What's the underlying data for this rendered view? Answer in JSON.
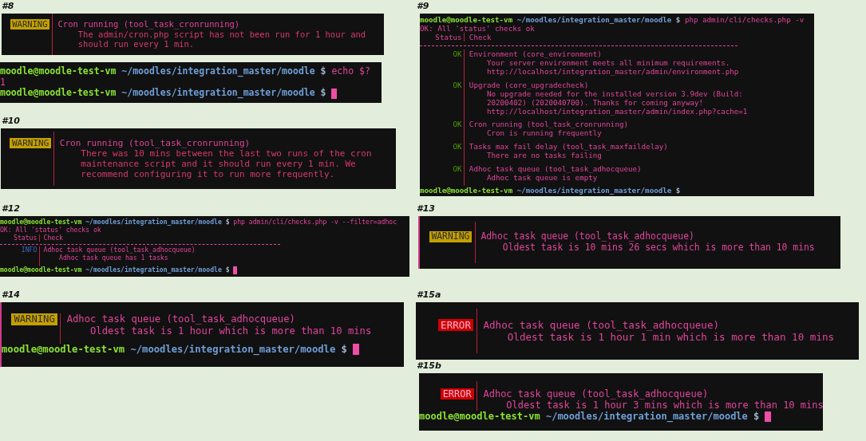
{
  "left_column": [
    {
      "label": "#8",
      "blocks": [
        {
          "lines": [
            {
              "kind": "spacer"
            },
            {
              "kind": "check",
              "status": {
                "kind": "warning",
                "text": "WARNING"
              },
              "title": "Cron running (tool_task_cronrunning)",
              "details": [
                "The admin/cron.php script has not been run for 1 hour and",
                "should run every 1 min."
              ]
            },
            {
              "kind": "spacer"
            }
          ]
        },
        {
          "lines": [
            {
              "kind": "prompt",
              "user_host": "moodle@moodle-test-vm",
              "path": "~/moodles/integration_master/moodle",
              "sigil": "$",
              "command": "echo $?"
            },
            {
              "kind": "text",
              "text": "1"
            },
            {
              "kind": "prompt",
              "user_host": "moodle@moodle-test-vm",
              "path": "~/moodles/integration_master/moodle",
              "sigil": "$",
              "cursor": true
            }
          ]
        }
      ]
    },
    {
      "label": "#10",
      "blocks": [
        {
          "lines": [
            {
              "kind": "spacer"
            },
            {
              "kind": "check",
              "status": {
                "kind": "warning",
                "text": "WARNING"
              },
              "title": "Cron running (tool_task_cronrunning)",
              "details": [
                "There was 10 mins between the last two runs of the cron",
                "maintenance script and it should run every 1 min. We",
                "recommend configuring it to run more frequently."
              ]
            },
            {
              "kind": "spacer"
            }
          ]
        }
      ]
    },
    {
      "label": "#12",
      "blocks": [
        {
          "lines": [
            {
              "kind": "prompt",
              "user_host": "moodle@moodle-test-vm",
              "path": "~/moodles/integration_master/moodle",
              "sigil": "$",
              "command": "php admin/cli/checks.php -v --filter=adhoc"
            },
            {
              "kind": "text",
              "text": "OK: All 'status' checks ok"
            },
            {
              "kind": "header",
              "status": "Status",
              "check": "Check"
            },
            {
              "kind": "rule"
            },
            {
              "kind": "check",
              "status": {
                "kind": "info",
                "text": "INFO"
              },
              "title": "Adhoc task queue (tool_task_adhocqueue)",
              "details": [
                "Adhoc task queue has 1 tasks"
              ]
            },
            {
              "kind": "spacer"
            },
            {
              "kind": "prompt",
              "user_host": "moodle@moodle-test-vm",
              "path": "~/moodles/integration_master/moodle",
              "sigil": "$",
              "cursor": true
            }
          ]
        }
      ]
    },
    {
      "label": "#14",
      "blocks": [
        {
          "lines": [
            {
              "kind": "check",
              "status": {
                "kind": "warning",
                "text": "WARNING"
              },
              "title": "Adhoc task queue (tool_task_adhocqueue)",
              "details": [
                "Oldest task is 1 hour which is more than 10 mins"
              ]
            },
            {
              "kind": "spacer"
            },
            {
              "kind": "prompt",
              "user_host": "moodle@moodle-test-vm",
              "path": "~/moodles/integration_master/moodle",
              "sigil": "$",
              "cursor": true
            }
          ]
        }
      ]
    }
  ],
  "right_column": [
    {
      "label": "#9",
      "blocks": [
        {
          "lines": [
            {
              "kind": "prompt",
              "user_host": "moodle@moodle-test-vm",
              "path": "~/moodles/integration_master/moodle",
              "sigil": "$",
              "command": "php admin/cli/checks.php -v"
            },
            {
              "kind": "text",
              "text": "OK: All 'status' checks ok"
            },
            {
              "kind": "header",
              "status": "Status",
              "check": "Check"
            },
            {
              "kind": "rule"
            },
            {
              "kind": "check",
              "status": {
                "kind": "ok",
                "text": "OK"
              },
              "title": "Environment (core_environment)",
              "details": [
                "Your server environment meets all minimum requirements.",
                "http://localhost/integration_master/admin/environment.php"
              ]
            },
            {
              "kind": "spacer"
            },
            {
              "kind": "check",
              "status": {
                "kind": "ok",
                "text": "OK"
              },
              "title": "Upgrade (core_upgradecheck)",
              "details": [
                "No upgrade needed for the installed version 3.9dev (Build:",
                "20200402) (2020040700). Thanks for coming anyway!",
                "http://localhost/integration_master/admin/index.php?cache=1"
              ]
            },
            {
              "kind": "spacer"
            },
            {
              "kind": "check",
              "status": {
                "kind": "ok",
                "text": "OK"
              },
              "title": "Cron running (tool_task_cronrunning)",
              "details": [
                "Cron is running frequently"
              ]
            },
            {
              "kind": "spacer"
            },
            {
              "kind": "check",
              "status": {
                "kind": "ok",
                "text": "OK"
              },
              "title": "Tasks max fail delay (tool_task_maxfaildelay)",
              "details": [
                "There are no tasks failing"
              ]
            },
            {
              "kind": "spacer"
            },
            {
              "kind": "check",
              "status": {
                "kind": "ok",
                "text": "OK"
              },
              "title": "Adhoc task queue (tool_task_adhocqueue)",
              "details": [
                "Adhoc task queue is empty"
              ]
            },
            {
              "kind": "spacer"
            },
            {
              "kind": "prompt",
              "user_host": "moodle@moodle-test-vm",
              "path": "~/moodles/integration_master/moodle",
              "sigil": "$"
            }
          ]
        }
      ]
    },
    {
      "label": "#13",
      "blocks": [
        {
          "lines": [
            {
              "kind": "spacer"
            },
            {
              "kind": "check",
              "status": {
                "kind": "warning",
                "text": "WARNING"
              },
              "title": "Adhoc task queue (tool_task_adhocqueue)",
              "details": [
                "Oldest task is 10 mins 26 secs which is more than 10 mins"
              ]
            },
            {
              "kind": "spacer"
            }
          ]
        }
      ]
    },
    {
      "label": "#15a",
      "blocks": [
        {
          "lines": [
            {
              "kind": "spacer"
            },
            {
              "kind": "check",
              "status": {
                "kind": "error",
                "text": "ERROR"
              },
              "title": "Adhoc task queue (tool_task_adhocqueue)",
              "details": [
                "Oldest task is 1 hour 1 min which is more than 10 mins"
              ]
            },
            {
              "kind": "spacer"
            }
          ]
        }
      ]
    },
    {
      "label": "#15b",
      "blocks": [
        {
          "lines": [
            {
              "kind": "spacer"
            },
            {
              "kind": "check",
              "status": {
                "kind": "error",
                "text": "ERROR"
              },
              "title": "Adhoc task queue (tool_task_adhocqueue)",
              "details": [
                "Oldest task is 1 hour 3 mins which is more than 10 mins"
              ]
            },
            {
              "kind": "prompt",
              "user_host": "moodle@moodle-test-vm",
              "path": "~/moodles/integration_master/moodle",
              "sigil": "$",
              "cursor": true
            }
          ]
        }
      ]
    }
  ]
}
